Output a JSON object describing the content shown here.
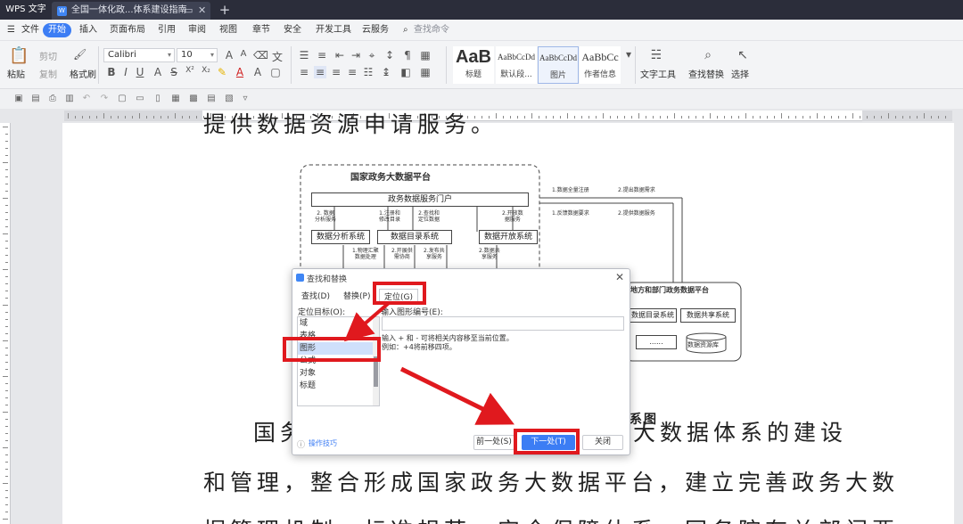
{
  "app": {
    "name": "WPS 文字"
  },
  "tab": {
    "title": "全国一体化政...体系建设指南",
    "icon": "wps-doc-icon"
  },
  "menu": {
    "items": [
      "文件",
      "开始",
      "插入",
      "页面布局",
      "引用",
      "审阅",
      "视图",
      "章节",
      "安全",
      "开发工具",
      "云服务"
    ],
    "active": "开始",
    "search_placeholder": "查找命令"
  },
  "toolbar": {
    "paste": "粘贴",
    "cut": "剪切",
    "copy": "复制",
    "format_painter": "格式刷",
    "font": "Calibri",
    "font_size": "10",
    "styles": [
      {
        "sample": "AaB",
        "label": "标题"
      },
      {
        "sample": "AaBbCcDd",
        "label": "默认段..."
      },
      {
        "sample": "AaBbCcDd",
        "label": "图片"
      },
      {
        "sample": "AaBbCc",
        "label": "作者信息"
      }
    ],
    "text_tools": "文字工具",
    "find_replace": "查找替换",
    "select": "选择"
  },
  "document": {
    "top_cut_line": "提供数据资源申请服务。",
    "figure_caption": "系图",
    "para1": "国务院办公厅负责全国一体化政务大数据体系的建设",
    "para1_left": "国务",
    "para1_right": "大数据体系的建设",
    "para2": "和管理，整合形成国家政务大数据平台，建立完善政务大数",
    "para3": "据管理机制、标准规范、安全保障体系。国务院有关部门要"
  },
  "diagram": {
    "platform_title": "国家政务大数据平台",
    "portal": "政务数据服务门户",
    "analysis_system": "数据分析系统",
    "catalog_system": "数据目录系统",
    "open_system": "数据开放系统",
    "labels": {
      "l1": "2. 数据\n分析服务",
      "l2": "1.注册和\n修改目录",
      "l3": "2.查找和\n定位数据",
      "l4": "2.开放数\n据服务",
      "l5": "1.物理汇聚\n数据处理",
      "l6": "2.开展供\n需协商",
      "l7": "2.发布共\n享服务",
      "l8": "2.数据共\n享服务"
    },
    "right_labels": [
      "1.数据全量注册",
      "2.提出数据需求",
      "1.反馈数据要求",
      "2.提供数据服务"
    ],
    "local_platform": "地方和部门政务数据平台",
    "local_catalog": "数据目录系统",
    "local_share": "数据共享系统",
    "local_dots": "......",
    "local_db": "数据资源库"
  },
  "dialog": {
    "title": "查找和替换",
    "tabs": [
      "查找(D)",
      "替换(P)",
      "定位(G)"
    ],
    "active_tab": "定位(G)",
    "target_label": "定位目标(O):",
    "targets": [
      "域",
      "表格",
      "图形",
      "公式",
      "对象",
      "标题"
    ],
    "selected_target": "图形",
    "input_label": "输入图形编号(E):",
    "input_value": "",
    "hint1": "输入 + 和 - 可将相关内容移至当前位置。",
    "hint2": "例如：+4将前移四项。",
    "tips_link": "操作技巧",
    "prev": "前一处(S)",
    "next": "下一处(T)",
    "close": "关闭"
  },
  "annotation_color": "#e0191e",
  "accent_color": "#3c7df4"
}
